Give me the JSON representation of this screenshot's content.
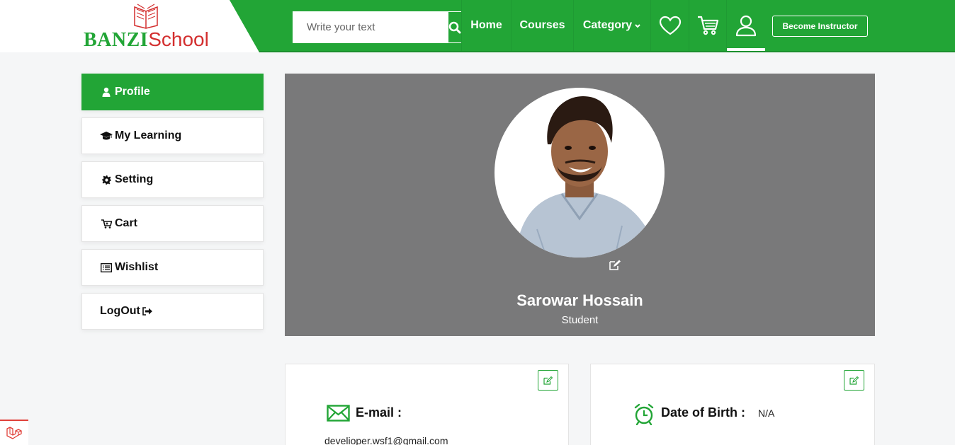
{
  "header": {
    "logo": {
      "part1": "BANZI",
      "part2": "School"
    },
    "search": {
      "placeholder": "Write your text",
      "value": ""
    },
    "nav": {
      "home": "Home",
      "courses": "Courses",
      "category": "Category"
    },
    "become_instructor": "Become Instructor"
  },
  "sidebar": {
    "items": [
      {
        "label": "Profile",
        "icon": "user-icon",
        "active": true
      },
      {
        "label": "My Learning",
        "icon": "graduation-cap-icon"
      },
      {
        "label": "Setting",
        "icon": "gear-icon"
      },
      {
        "label": "Cart",
        "icon": "cart-icon"
      },
      {
        "label": "Wishlist",
        "icon": "list-icon"
      },
      {
        "label": "LogOut",
        "icon": "sign-out-icon"
      }
    ]
  },
  "profile": {
    "name": "Sarowar Hossain",
    "role": "Student"
  },
  "cards": {
    "email": {
      "label": "E-mail :",
      "value": "develioper.wsf1@gmail.com"
    },
    "dob": {
      "label": "Date of Birth :",
      "value": "N/A"
    }
  },
  "colors": {
    "brand_green": "#22a536",
    "banner_gray": "#79797a",
    "logo_red": "#d32f2f"
  }
}
